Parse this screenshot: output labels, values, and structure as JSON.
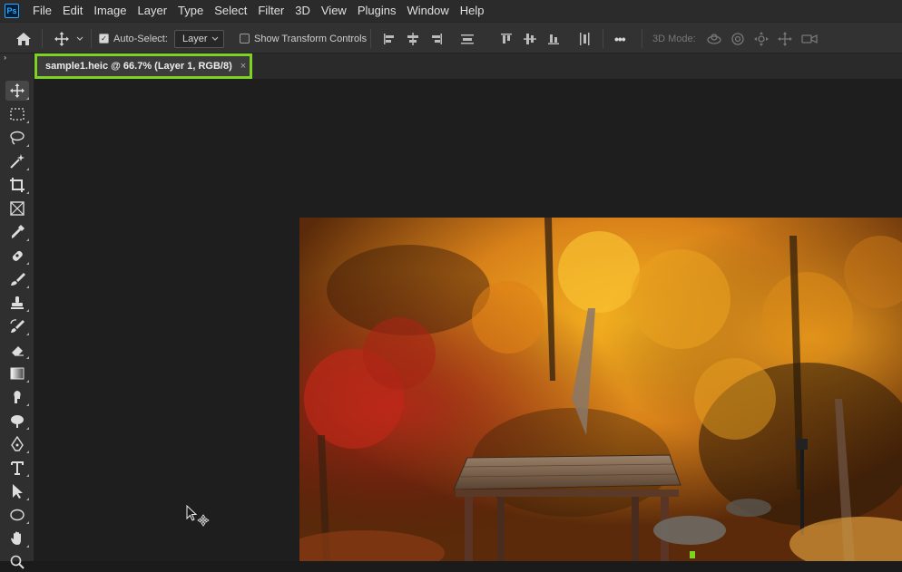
{
  "app": {
    "logo": "Ps"
  },
  "menu": [
    "File",
    "Edit",
    "Image",
    "Layer",
    "Type",
    "Select",
    "Filter",
    "3D",
    "View",
    "Plugins",
    "Window",
    "Help"
  ],
  "options": {
    "auto_select_label": "Auto-Select:",
    "auto_select_checked": true,
    "layer_dropdown": "Layer",
    "show_transform_label": "Show Transform Controls",
    "show_transform_checked": false,
    "more_label": "•••",
    "mode_3d_label": "3D Mode:"
  },
  "document": {
    "tab_title": "sample1.heic @ 66.7% (Layer 1, RGB/8)",
    "close_glyph": "×",
    "highlight_color": "#7ed321"
  },
  "tools": [
    "move-tool-icon",
    "marquee-tool-icon",
    "lasso-tool-icon",
    "magic-wand-tool-icon",
    "crop-tool-icon",
    "frame-tool-icon",
    "eyedropper-tool-icon",
    "healing-brush-tool-icon",
    "brush-tool-icon",
    "clone-stamp-tool-icon",
    "history-brush-tool-icon",
    "eraser-tool-icon",
    "gradient-tool-icon",
    "smudge-tool-icon",
    "dodge-tool-icon",
    "pen-tool-icon",
    "type-tool-icon",
    "path-selection-tool-icon",
    "ellipse-tool-icon",
    "hand-tool-icon",
    "zoom-tool-icon"
  ],
  "colors": {
    "accent": "#31a8ff",
    "menubar": "#2b2b2b",
    "canvas": "#1e1e1e"
  }
}
